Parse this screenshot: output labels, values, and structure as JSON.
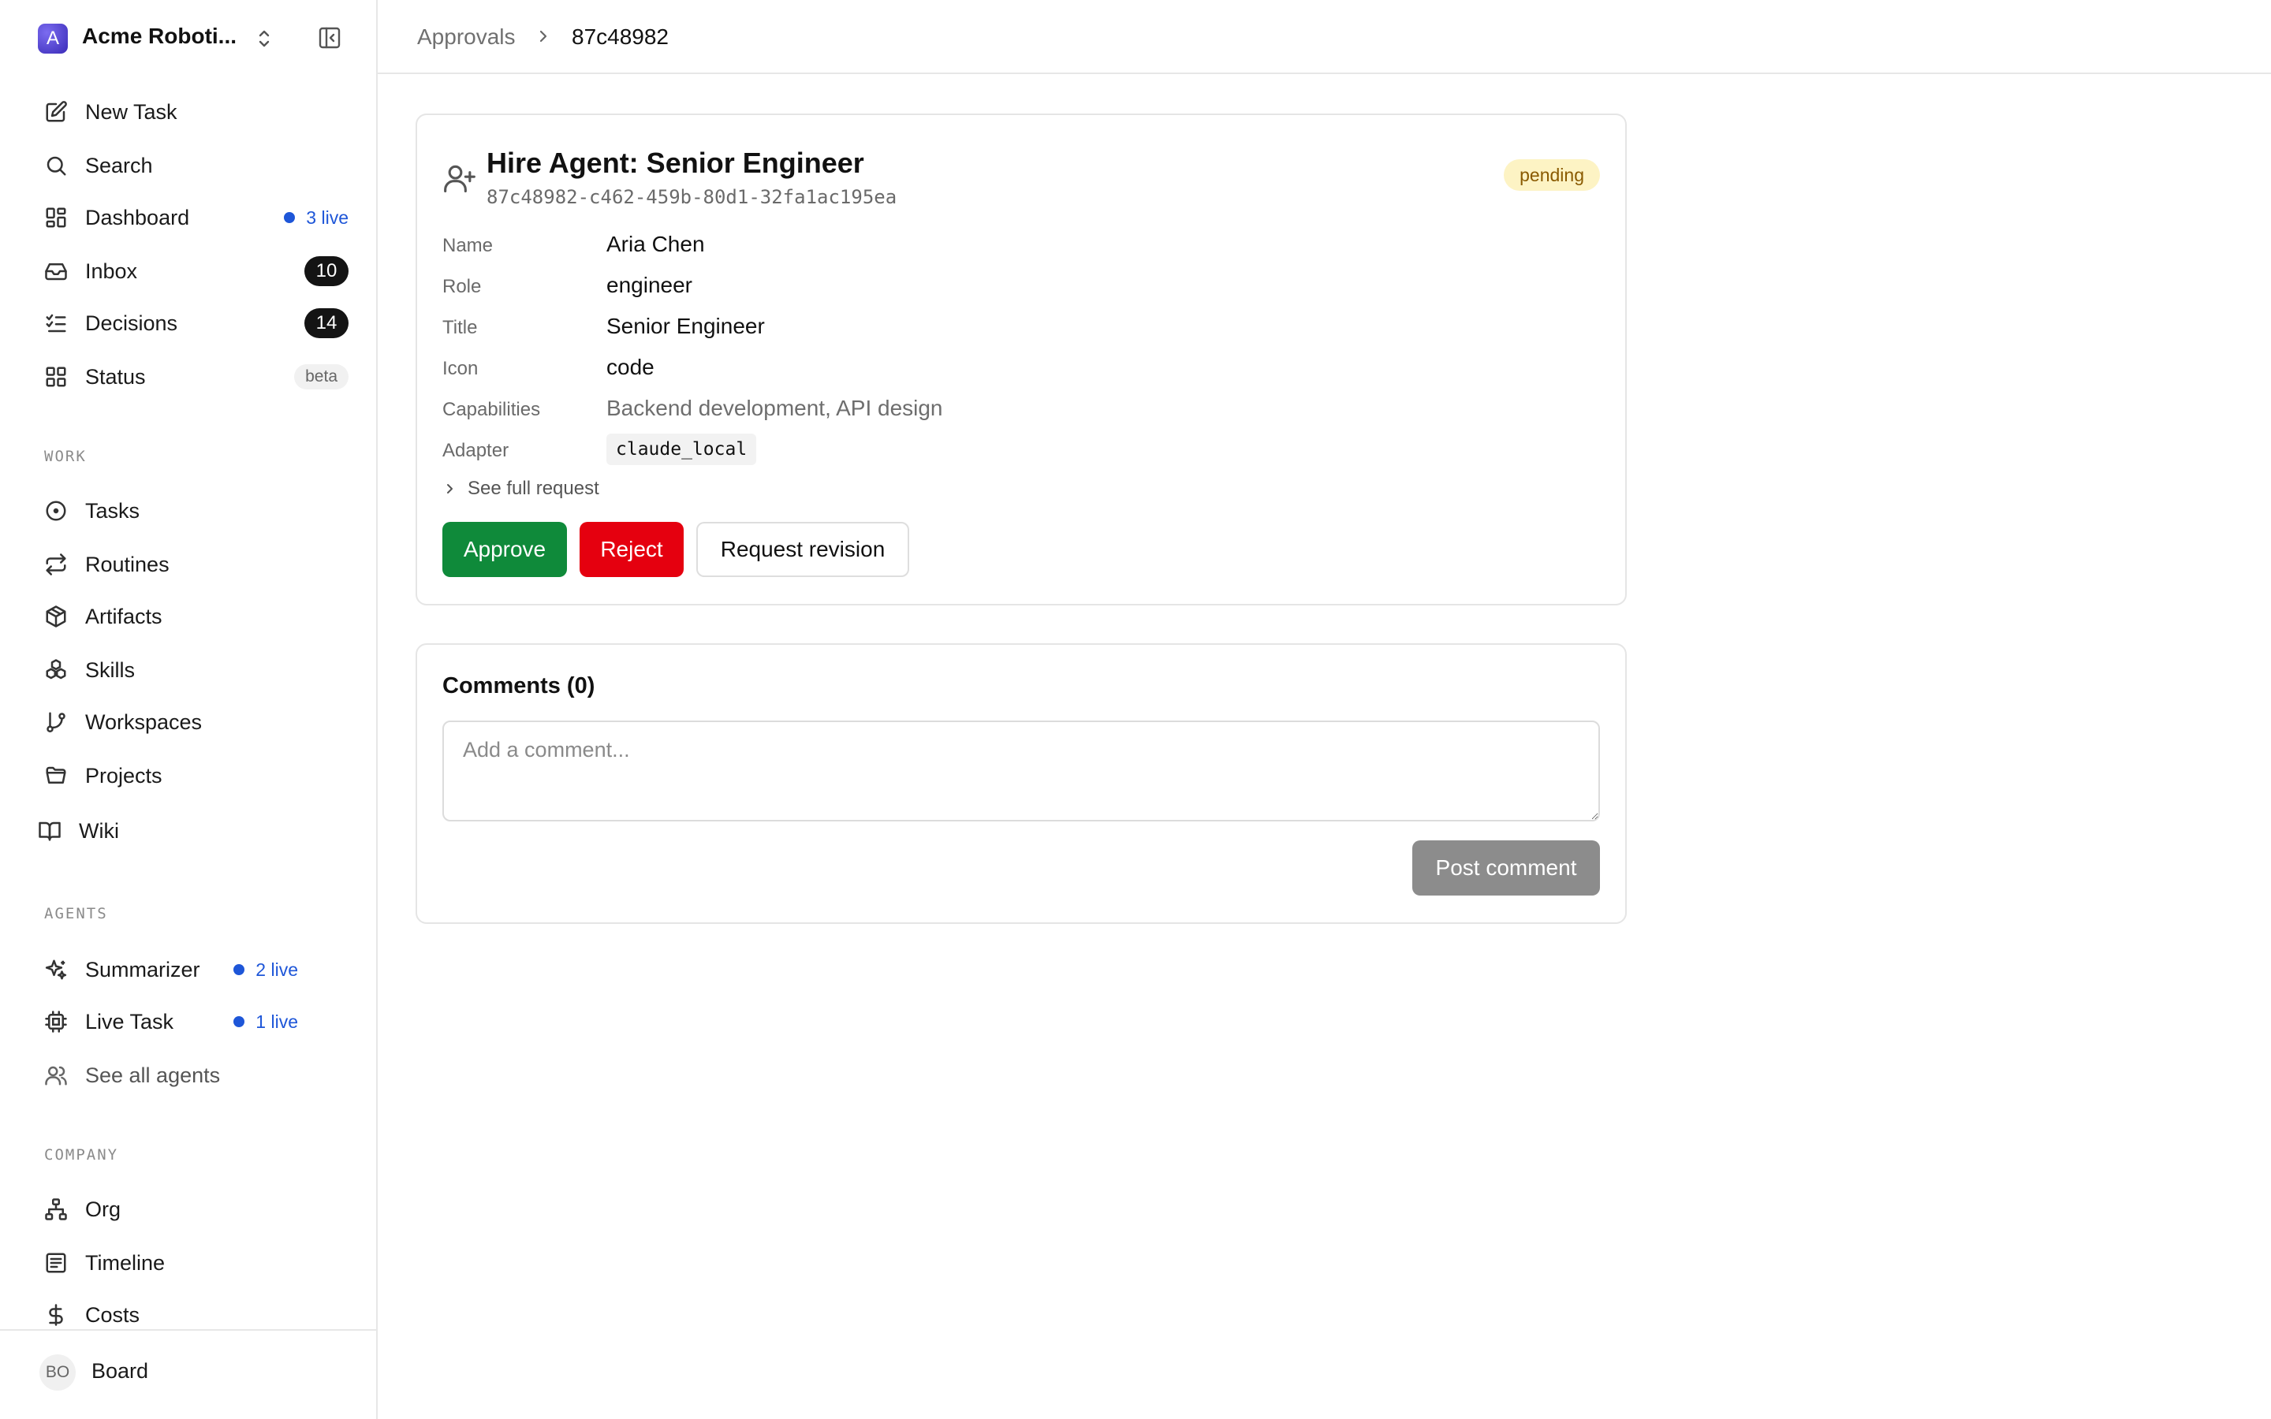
{
  "sidebar": {
    "company": {
      "logo_letter": "A",
      "name": "Acme Roboti..."
    },
    "primary": [
      {
        "label": "New Task",
        "icon": "edit-icon"
      },
      {
        "label": "Search",
        "icon": "search-icon"
      },
      {
        "label": "Dashboard",
        "icon": "dashboard-icon",
        "live": "3 live"
      },
      {
        "label": "Inbox",
        "icon": "inbox-icon",
        "count": "10"
      },
      {
        "label": "Decisions",
        "icon": "checklist-icon",
        "count": "14"
      },
      {
        "label": "Status",
        "icon": "grid-icon",
        "badge": "beta"
      }
    ],
    "work_label": "WORK",
    "work": [
      {
        "label": "Tasks",
        "icon": "circle-dot-icon"
      },
      {
        "label": "Routines",
        "icon": "repeat-icon"
      },
      {
        "label": "Artifacts",
        "icon": "package-icon"
      },
      {
        "label": "Skills",
        "icon": "boxes-icon"
      },
      {
        "label": "Workspaces",
        "icon": "git-branch-icon"
      },
      {
        "label": "Projects",
        "icon": "folder-icon"
      },
      {
        "label": "Wiki",
        "icon": "book-icon"
      }
    ],
    "agents_label": "AGENTS",
    "agents": [
      {
        "label": "Summarizer",
        "icon": "sparkles-icon",
        "live": "2 live"
      },
      {
        "label": "Live Task",
        "icon": "cpu-icon",
        "live": "1 live"
      },
      {
        "label": "See all agents",
        "icon": "users-icon"
      }
    ],
    "company_label": "COMPANY",
    "company_items": [
      {
        "label": "Org",
        "icon": "org-chart-icon"
      },
      {
        "label": "Timeline",
        "icon": "timeline-icon"
      },
      {
        "label": "Costs",
        "icon": "dollar-icon"
      }
    ],
    "user": {
      "initials": "BO",
      "label": "Board"
    }
  },
  "breadcrumb": {
    "parent": "Approvals",
    "current": "87c48982"
  },
  "approval": {
    "title": "Hire Agent: Senior Engineer",
    "id": "87c48982-c462-459b-80d1-32fa1ac195ea",
    "status": "pending",
    "fields": [
      {
        "label": "Name",
        "value": "Aria Chen"
      },
      {
        "label": "Role",
        "value": "engineer"
      },
      {
        "label": "Title",
        "value": "Senior Engineer"
      },
      {
        "label": "Icon",
        "value": "code"
      },
      {
        "label": "Capabilities",
        "value": "Backend development, API design"
      },
      {
        "label": "Adapter",
        "value": "claude_local"
      }
    ],
    "see_full": "See full request",
    "actions": {
      "approve": "Approve",
      "reject": "Reject",
      "revise": "Request revision"
    }
  },
  "comments": {
    "title": "Comments (0)",
    "placeholder": "Add a comment...",
    "post_label": "Post comment"
  },
  "colors": {
    "approve": "#0f8a3a",
    "reject": "#e5000f",
    "live": "#1e56d8",
    "pending_bg": "#fdf3c4",
    "pending_text": "#8a5a00"
  }
}
